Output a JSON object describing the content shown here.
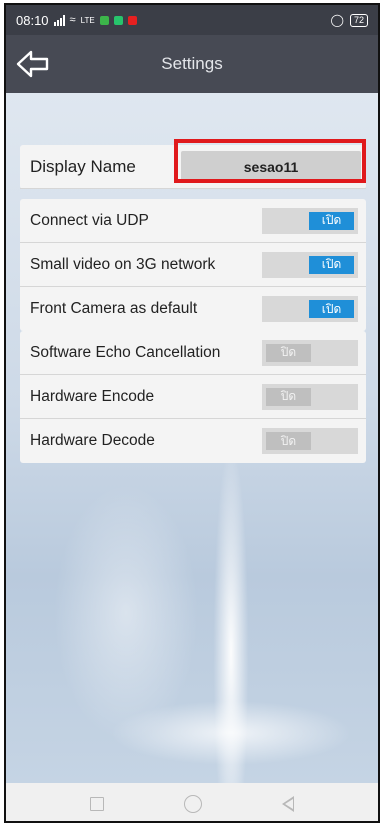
{
  "status_bar": {
    "time": "08:10",
    "network_label": "LTE",
    "battery": "72"
  },
  "app_bar": {
    "title": "Settings"
  },
  "display_name": {
    "label": "Display Name",
    "value": "sesao11"
  },
  "group1": [
    {
      "label": "Connect via UDP",
      "toggle": "เปิด",
      "on": true
    },
    {
      "label": "Small video on 3G network",
      "toggle": "เปิด",
      "on": true
    },
    {
      "label": "Front Camera as default",
      "toggle": "เปิด",
      "on": true
    }
  ],
  "group2": [
    {
      "label": "Software Echo Cancellation",
      "toggle": "ปิด",
      "on": false
    },
    {
      "label": "Hardware Encode",
      "toggle": "ปิด",
      "on": false
    },
    {
      "label": "Hardware Decode",
      "toggle": "ปิด",
      "on": false
    }
  ],
  "colors": {
    "accent": "#1f8fd8",
    "highlight": "#e0191c",
    "appbar": "#474a54"
  }
}
